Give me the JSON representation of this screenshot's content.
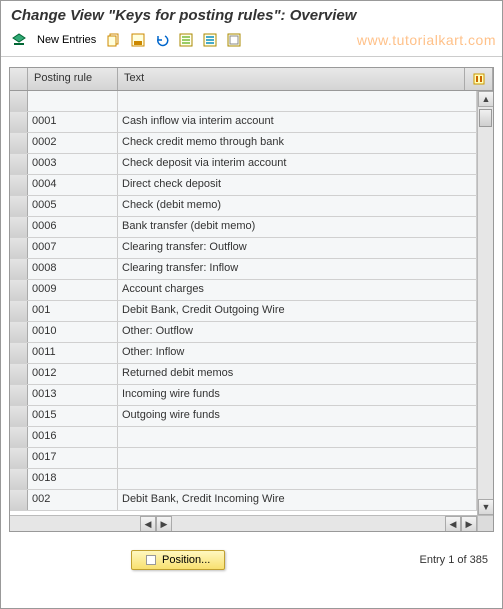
{
  "title": "Change View \"Keys for posting rules\": Overview",
  "watermark": "www.tutorialkart.com",
  "toolbar": {
    "new_entries": "New Entries"
  },
  "table": {
    "columns": {
      "rule": "Posting rule",
      "text": "Text"
    },
    "rows": [
      {
        "rule": "",
        "text": ""
      },
      {
        "rule": "0001",
        "text": "Cash inflow via interim account"
      },
      {
        "rule": "0002",
        "text": "Check credit memo through bank"
      },
      {
        "rule": "0003",
        "text": "Check deposit via interim account"
      },
      {
        "rule": "0004",
        "text": "Direct check deposit"
      },
      {
        "rule": "0005",
        "text": "Check (debit memo)"
      },
      {
        "rule": "0006",
        "text": "Bank transfer (debit memo)"
      },
      {
        "rule": "0007",
        "text": "Clearing transfer: Outflow"
      },
      {
        "rule": "0008",
        "text": "Clearing transfer: Inflow"
      },
      {
        "rule": "0009",
        "text": "Account charges"
      },
      {
        "rule": "001",
        "text": "Debit Bank, Credit Outgoing Wire"
      },
      {
        "rule": "0010",
        "text": "Other: Outflow"
      },
      {
        "rule": "0011",
        "text": "Other: Inflow"
      },
      {
        "rule": "0012",
        "text": "Returned debit memos"
      },
      {
        "rule": "0013",
        "text": "Incoming wire funds"
      },
      {
        "rule": "0015",
        "text": "Outgoing wire funds"
      },
      {
        "rule": "0016",
        "text": ""
      },
      {
        "rule": "0017",
        "text": ""
      },
      {
        "rule": "0018",
        "text": ""
      },
      {
        "rule": "002",
        "text": "Debit Bank, Credit Incoming Wire"
      }
    ]
  },
  "footer": {
    "position_label": "Position...",
    "entry_text": "Entry 1 of 385"
  }
}
